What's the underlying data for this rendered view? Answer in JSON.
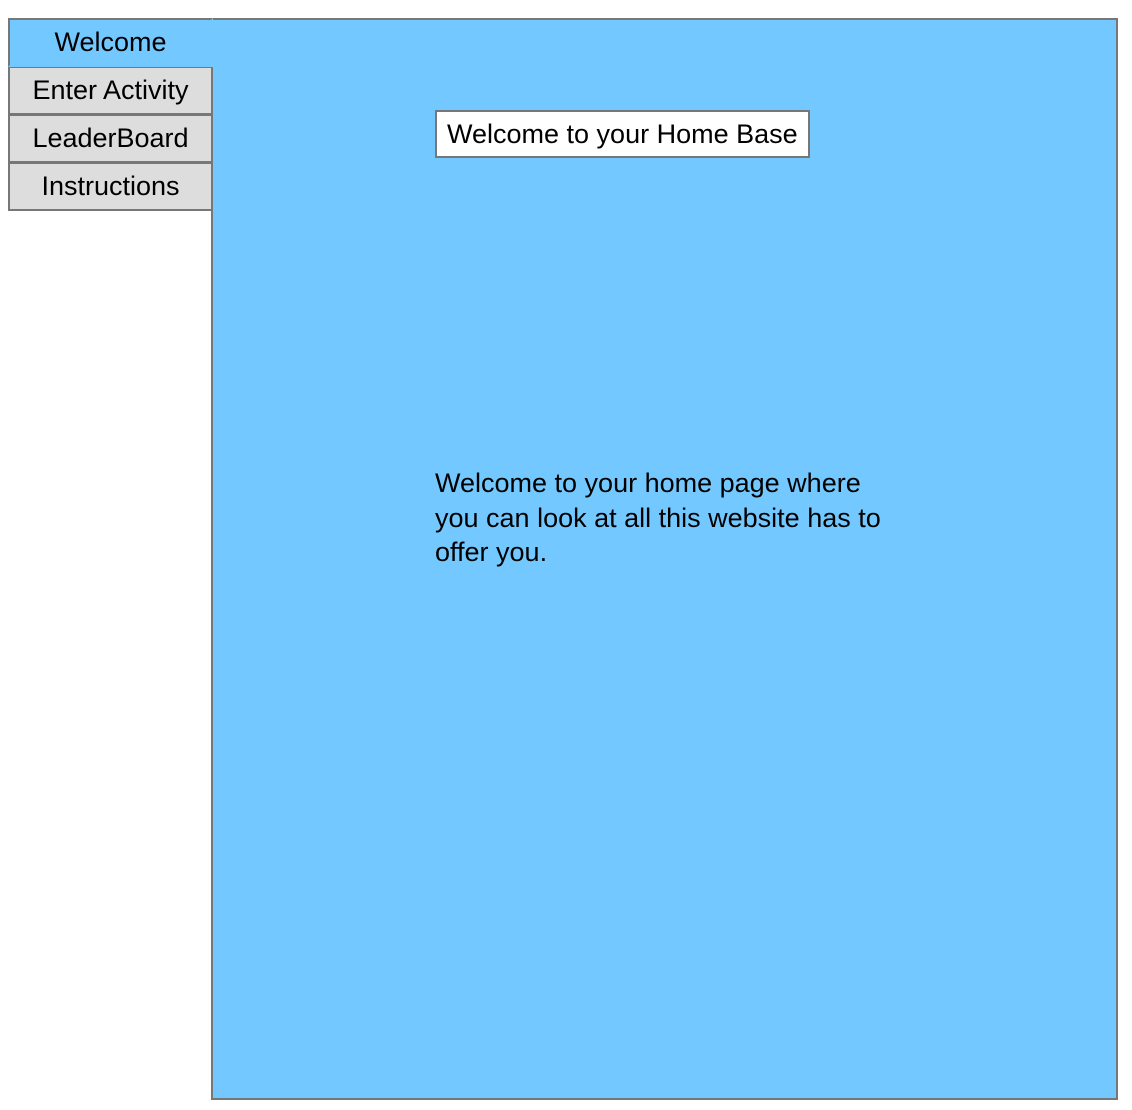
{
  "nav": {
    "tabs": [
      {
        "label": "Welcome",
        "active": true
      },
      {
        "label": "Enter Activity",
        "active": false
      },
      {
        "label": "LeaderBoard",
        "active": false
      },
      {
        "label": "Instructions",
        "active": false
      }
    ]
  },
  "main": {
    "title": "Welcome to your Home Base",
    "body_text": "Welcome to your home page where you can look at all this website has to offer you."
  },
  "colors": {
    "panel_background": "#73c9ff",
    "tab_background": "#dddddd",
    "border": "#777777"
  }
}
